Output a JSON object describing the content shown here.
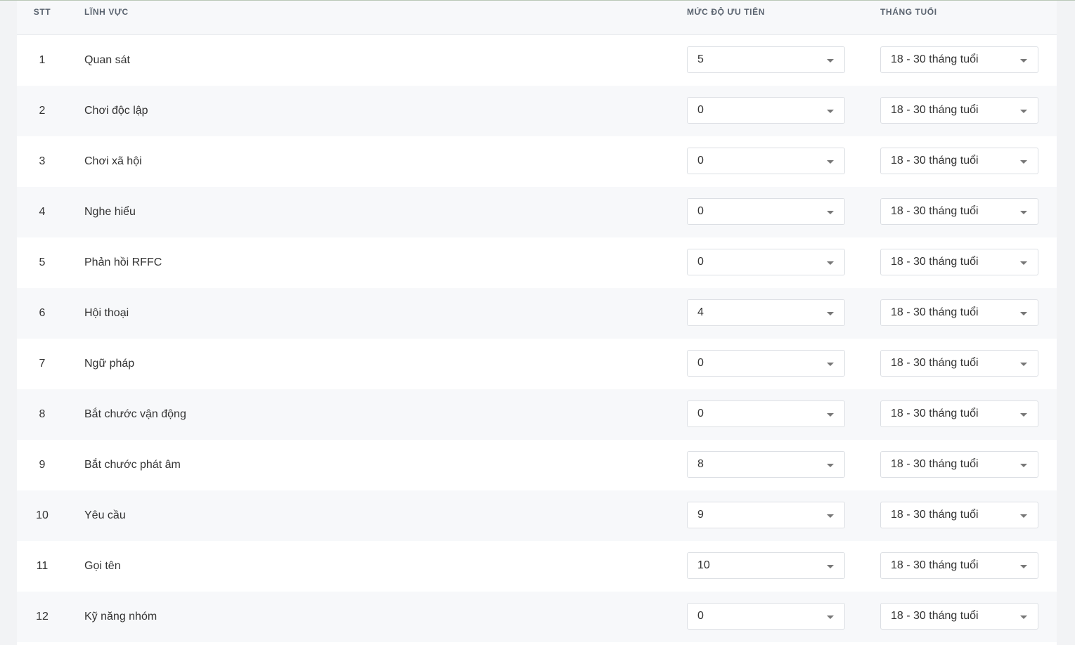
{
  "table": {
    "headers": {
      "stt": "STT",
      "field": "LĨNH VỰC",
      "priority": "MỨC ĐỘ ƯU TIÊN",
      "age": "THÁNG TUỔI"
    },
    "rows": [
      {
        "stt": "1",
        "field": "Quan sát",
        "priority": "5",
        "age": "18 - 30 tháng tuổi"
      },
      {
        "stt": "2",
        "field": "Chơi độc lập",
        "priority": "0",
        "age": "18 - 30 tháng tuổi"
      },
      {
        "stt": "3",
        "field": "Chơi xã hội",
        "priority": "0",
        "age": "18 - 30 tháng tuổi"
      },
      {
        "stt": "4",
        "field": "Nghe hiểu",
        "priority": "0",
        "age": "18 - 30 tháng tuổi"
      },
      {
        "stt": "5",
        "field": "Phản hồi RFFC",
        "priority": "0",
        "age": "18 - 30 tháng tuổi"
      },
      {
        "stt": "6",
        "field": "Hội thoại",
        "priority": "4",
        "age": "18 - 30 tháng tuổi"
      },
      {
        "stt": "7",
        "field": "Ngữ pháp",
        "priority": "0",
        "age": "18 - 30 tháng tuổi"
      },
      {
        "stt": "8",
        "field": "Bắt chước vận động",
        "priority": "0",
        "age": "18 - 30 tháng tuổi"
      },
      {
        "stt": "9",
        "field": "Bắt chước phát âm",
        "priority": "8",
        "age": "18 - 30 tháng tuổi"
      },
      {
        "stt": "10",
        "field": "Yêu cầu",
        "priority": "9",
        "age": "18 - 30 tháng tuổi"
      },
      {
        "stt": "11",
        "field": "Gọi tên",
        "priority": "10",
        "age": "18 - 30 tháng tuổi"
      },
      {
        "stt": "12",
        "field": "Kỹ năng nhóm",
        "priority": "0",
        "age": "18 - 30 tháng tuổi"
      }
    ]
  },
  "icons": {
    "dropdown": "chevron-down-icon"
  }
}
